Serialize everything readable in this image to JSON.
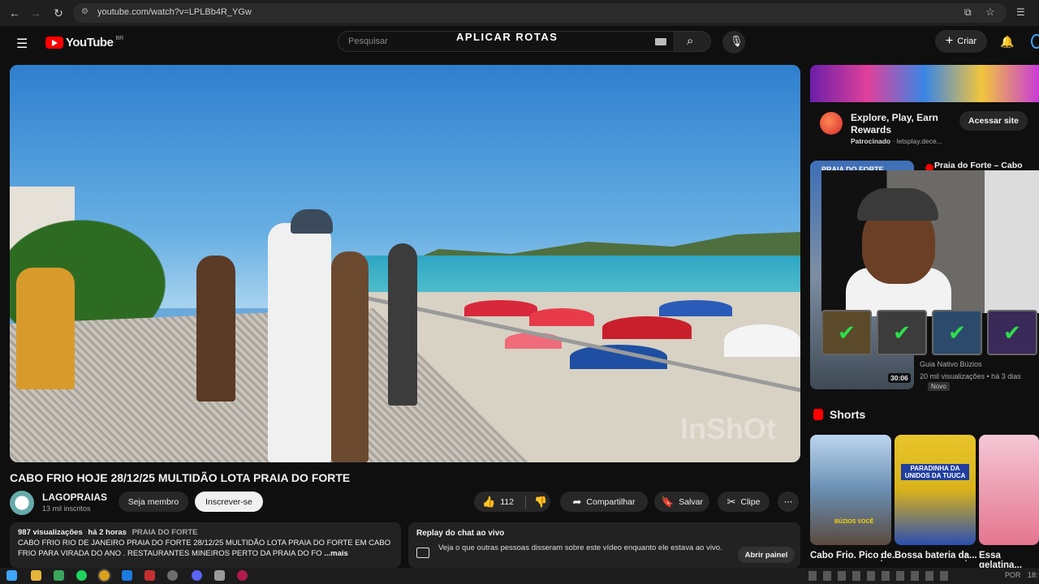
{
  "browser": {
    "url": "youtube.com/watch?v=LPLBb4R_YGw"
  },
  "header": {
    "logo_text": "YouTube",
    "region": "BR",
    "search_placeholder": "Pesquisar",
    "overlay_text": "APLICAR ROTAS",
    "create_label": "Criar"
  },
  "video": {
    "watermark": "InShOt",
    "title": "CABO FRIO HOJE 28/12/25 MULTIDÃO LOTA PRAIA DO FORTE",
    "channel": {
      "name": "LAGOPRAIAS",
      "subs": "13 mil inscritos"
    },
    "member_label": "Seja membro",
    "subscribe_label": "Inscrever-se",
    "likes": "112",
    "share_label": "Compartilhar",
    "save_label": "Salvar",
    "clip_label": "Clipe",
    "description": {
      "views": "987 visualizações",
      "time": "há 2 horas",
      "tag": "PRAIA DO FORTE",
      "text": "CABO FRIO RIO DE JANEIRO PRAIA DO FORTE 28/12/25 MULTIDÃO LOTA PRAIA DO FORTE EM CABO FRIO PARA VIRADA DO ANO . RESTAURANTES MINEIROS PERTO DA PRAIA DO FO",
      "more": "...mais"
    },
    "chat": {
      "title": "Replay do chat ao vivo",
      "text": "Veja o que outras pessoas disseram sobre este vídeo enquanto ele estava ao vivo.",
      "button": "Abrir painel"
    }
  },
  "sidebar": {
    "ad": {
      "title": "Explore, Play, Earn Rewards",
      "sponsored": "Patrocinado",
      "domain": "· letsplay.dece...",
      "cta": "Acessar site"
    },
    "rec": {
      "title": "Praia do Forte – Cabo Frio",
      "thumb_text": "PRAIA DO FORTE",
      "channel": "Guia Nativo Búzios",
      "meta": "20 mil visualizações • há 3 dias",
      "badge": "Novo",
      "duration": "30:06"
    },
    "shorts": {
      "heading": "Shorts",
      "items": [
        {
          "title": "Cabo Frio. Pico de...",
          "label": "BÚZIOS VOCÊ"
        },
        {
          "title": "Bossa bateria da...",
          "label": "PARADINHA DA UNIDOS DA TUUCA"
        },
        {
          "title": "Essa gelatina..."
        }
      ]
    }
  },
  "taskbar": {
    "lang": "POR",
    "time": "18:"
  },
  "colors": {
    "accent": "#ff0000",
    "bg": "#0f0f0f",
    "check": "#2de04a"
  },
  "icons": [
    "menu-icon",
    "search-icon",
    "mic-icon",
    "bell-icon",
    "like-icon",
    "dislike-icon",
    "share-icon",
    "save-icon",
    "clip-icon",
    "more-icon",
    "chat-icon",
    "shorts-icon"
  ]
}
